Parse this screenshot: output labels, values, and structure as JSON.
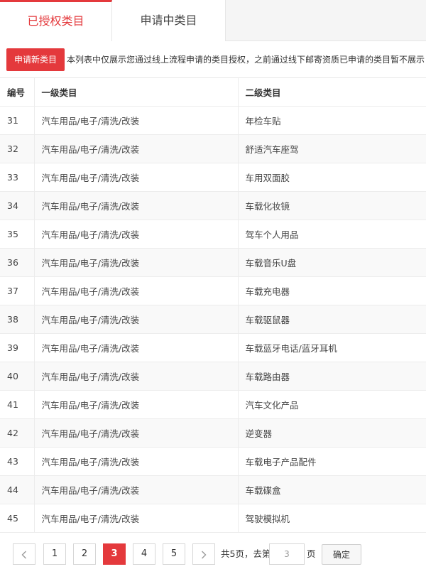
{
  "tabs": [
    {
      "label": "已授权类目"
    },
    {
      "label": "申请中类目"
    }
  ],
  "notice": {
    "apply_button": "申请新类目",
    "text": "本列表中仅展示您通过线上流程申请的类目授权，之前通过线下邮寄资质已申请的类目暂不展示"
  },
  "table": {
    "headers": [
      "编号",
      "一级类目",
      "二级类目"
    ],
    "rows": [
      {
        "id": "31",
        "level1": "汽车用品/电子/清洗/改装",
        "level2": "年检车贴"
      },
      {
        "id": "32",
        "level1": "汽车用品/电子/清洗/改装",
        "level2": "舒适汽车座驾"
      },
      {
        "id": "33",
        "level1": "汽车用品/电子/清洗/改装",
        "level2": "车用双面胶"
      },
      {
        "id": "34",
        "level1": "汽车用品/电子/清洗/改装",
        "level2": "车载化妆镜"
      },
      {
        "id": "35",
        "level1": "汽车用品/电子/清洗/改装",
        "level2": "驾车个人用品"
      },
      {
        "id": "36",
        "level1": "汽车用品/电子/清洗/改装",
        "level2": "车载音乐U盘"
      },
      {
        "id": "37",
        "level1": "汽车用品/电子/清洗/改装",
        "level2": "车载充电器"
      },
      {
        "id": "38",
        "level1": "汽车用品/电子/清洗/改装",
        "level2": "车载驱鼠器"
      },
      {
        "id": "39",
        "level1": "汽车用品/电子/清洗/改装",
        "level2": "车载蓝牙电话/蓝牙耳机"
      },
      {
        "id": "40",
        "level1": "汽车用品/电子/清洗/改装",
        "level2": "车载路由器"
      },
      {
        "id": "41",
        "level1": "汽车用品/电子/清洗/改装",
        "level2": "汽车文化产品"
      },
      {
        "id": "42",
        "level1": "汽车用品/电子/清洗/改装",
        "level2": "逆变器"
      },
      {
        "id": "43",
        "level1": "汽车用品/电子/清洗/改装",
        "level2": "车载电子产品配件"
      },
      {
        "id": "44",
        "level1": "汽车用品/电子/清洗/改装",
        "level2": "车载碟盒"
      },
      {
        "id": "45",
        "level1": "汽车用品/电子/清洗/改装",
        "level2": "驾驶模拟机"
      }
    ]
  },
  "pagination": {
    "prev_icon": "chevron-left-icon",
    "next_icon": "chevron-right-icon",
    "pages": [
      "1",
      "2",
      "3",
      "4",
      "5"
    ],
    "current_page": "3",
    "total_text": "共5页，去第",
    "goto_value": "3",
    "page_suffix": "页",
    "confirm_label": "确定"
  },
  "colors": {
    "accent": "#e4393c"
  }
}
